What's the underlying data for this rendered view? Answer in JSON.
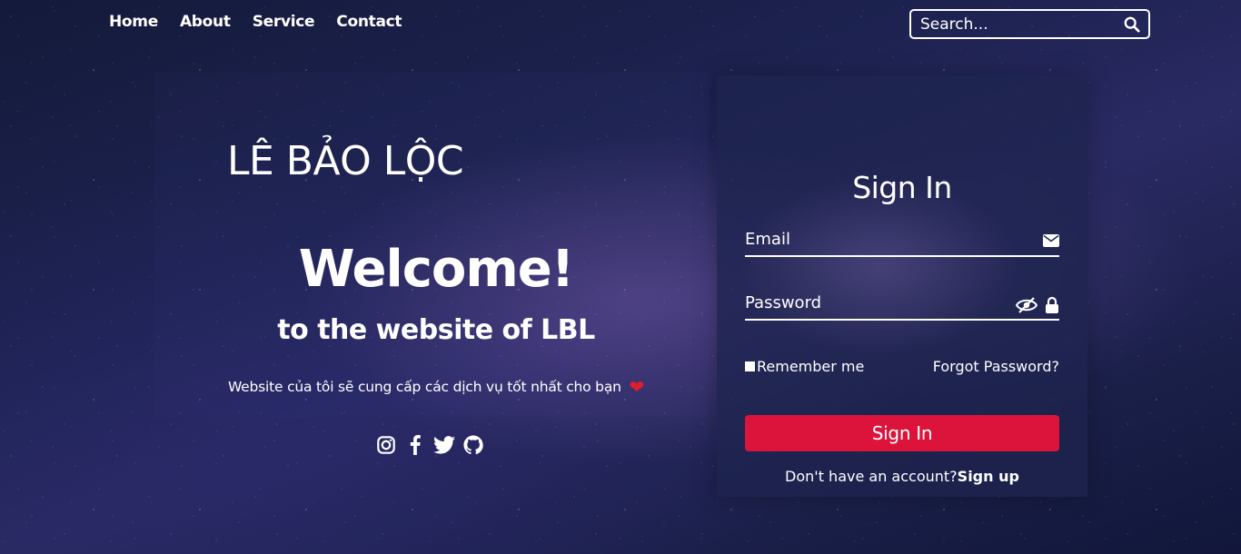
{
  "nav": {
    "items": [
      {
        "label": "Home"
      },
      {
        "label": "About"
      },
      {
        "label": "Service"
      },
      {
        "label": "Contact"
      }
    ]
  },
  "search": {
    "placeholder": "Search...",
    "icon": "search-icon"
  },
  "hero": {
    "name": "LÊ BẢO LỘC",
    "welcome": "Welcome!",
    "subtitle": "to the website of LBL",
    "description": "Website của tôi sẽ cung cấp các dịch vụ tốt nhất cho bạn",
    "heart": "❤️",
    "socials": [
      "instagram-icon",
      "facebook-icon",
      "twitter-icon",
      "github-icon"
    ]
  },
  "signin": {
    "title": "Sign In",
    "email_label": "Email",
    "password_label": "Password",
    "remember_label": "Remember me",
    "forgot_label": "Forgot Password?",
    "button_label": "Sign In",
    "no_account_text": "Don't have an account?",
    "signup_label": "Sign up",
    "accent_color": "#dc143c"
  }
}
